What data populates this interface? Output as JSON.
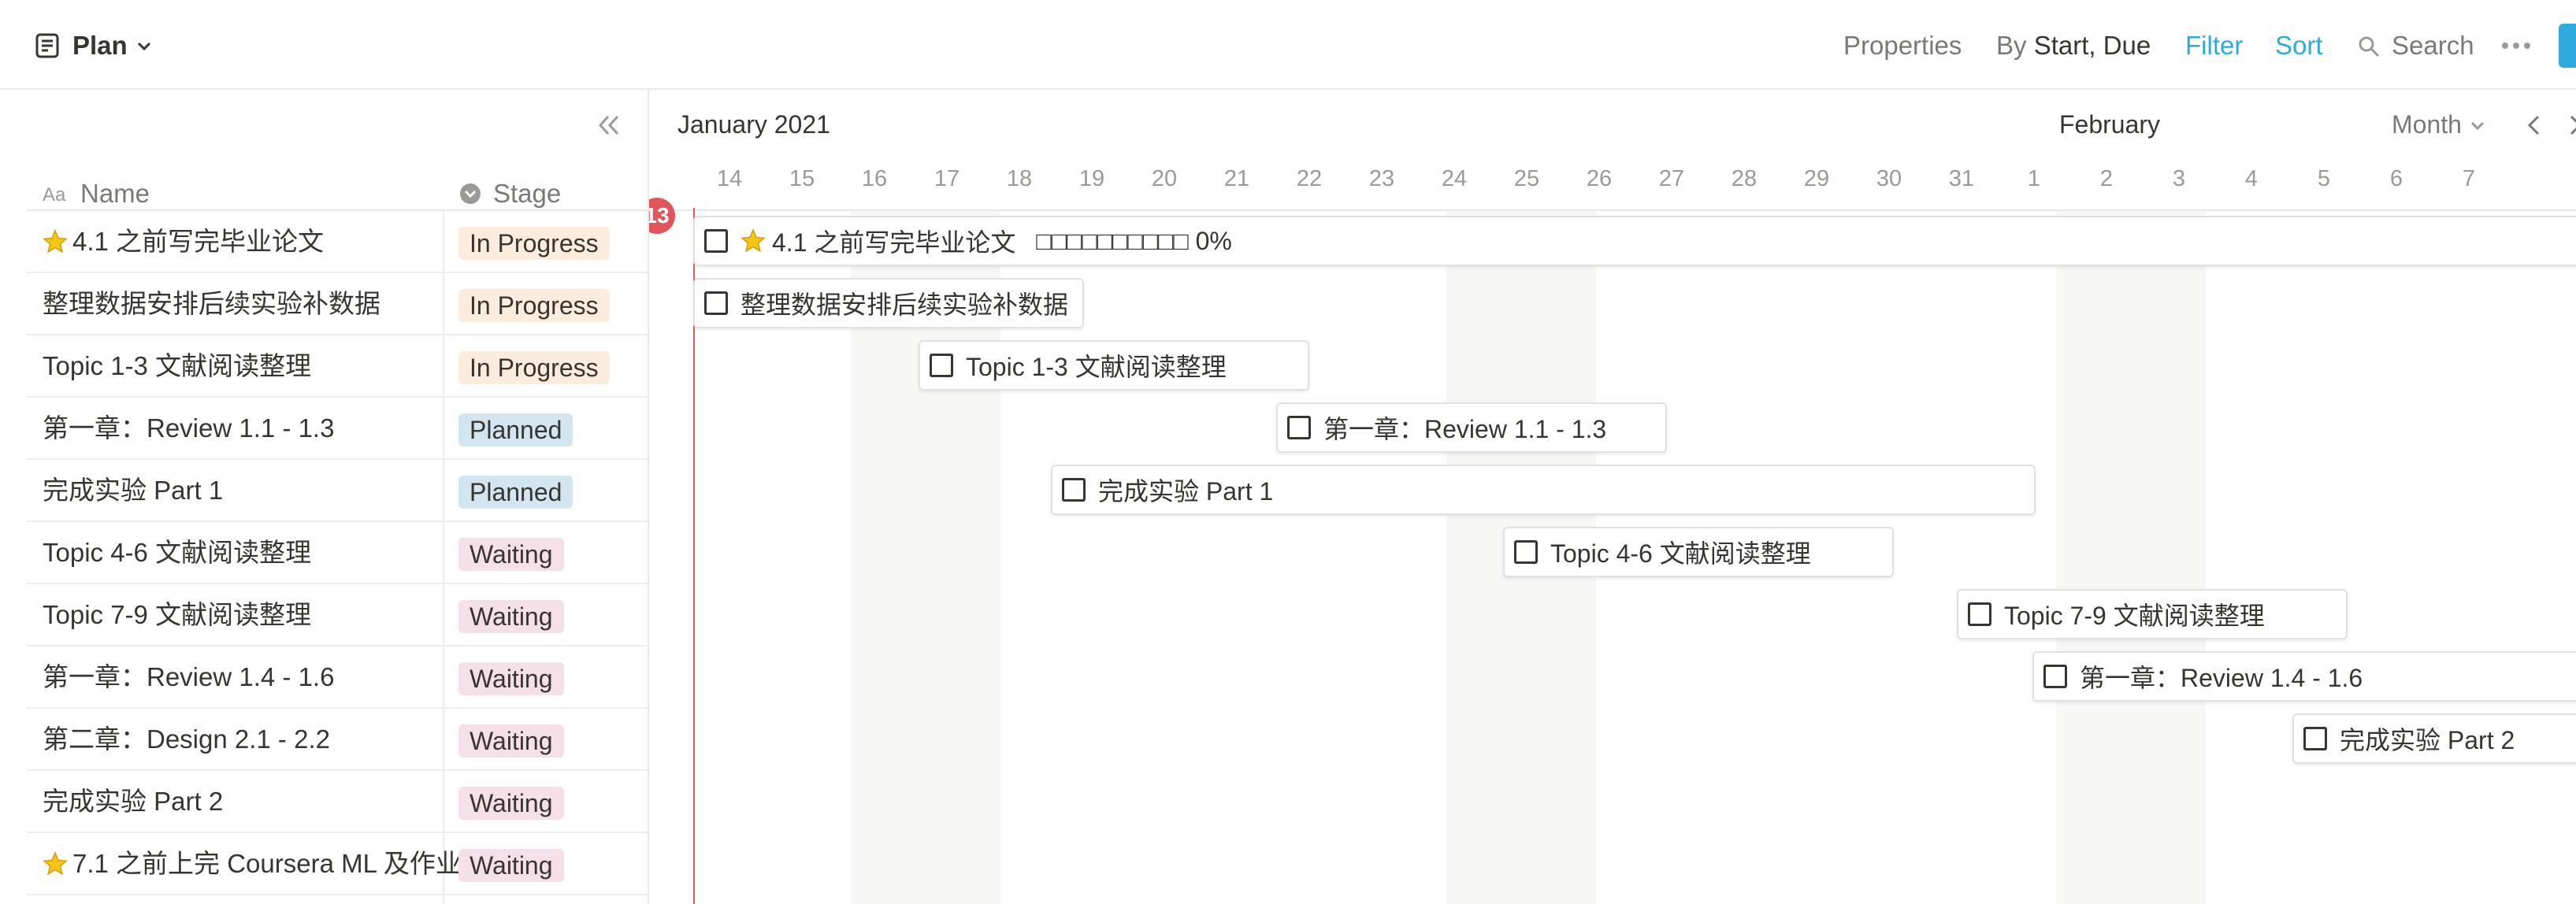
{
  "view": {
    "title": "Plan"
  },
  "toolbar": {
    "properties": "Properties",
    "by_prefix": "By",
    "by_value": "Start, Due",
    "filter": "Filter",
    "sort": "Sort",
    "search": "Search"
  },
  "table": {
    "columns": {
      "name": "Name",
      "stage": "Stage"
    },
    "rows": [
      {
        "name": "4.1 之前写完毕业论文",
        "starred": true,
        "stage": "In Progress"
      },
      {
        "name": "整理数据安排后续实验补数据",
        "starred": false,
        "stage": "In Progress"
      },
      {
        "name": "Topic 1-3 文献阅读整理",
        "starred": false,
        "stage": "In Progress"
      },
      {
        "name": "第一章：Review 1.1 - 1.3",
        "starred": false,
        "stage": "Planned"
      },
      {
        "name": "完成实验 Part 1",
        "starred": false,
        "stage": "Planned"
      },
      {
        "name": "Topic 4-6 文献阅读整理",
        "starred": false,
        "stage": "Waiting"
      },
      {
        "name": "Topic 7-9 文献阅读整理",
        "starred": false,
        "stage": "Waiting"
      },
      {
        "name": "第一章：Review 1.4 - 1.6",
        "starred": false,
        "stage": "Waiting"
      },
      {
        "name": "第二章：Design 2.1 - 2.2",
        "starred": false,
        "stage": "Waiting"
      },
      {
        "name": "完成实验 Part 2",
        "starred": false,
        "stage": "Waiting"
      },
      {
        "name": "7.1 之前上完 Coursera ML 及作业",
        "starred": true,
        "stage": "Waiting"
      }
    ]
  },
  "timeline": {
    "month_jan": "January 2021",
    "month_feb": "February",
    "zoom": "Month",
    "today": "13",
    "days": [
      "14",
      "15",
      "16",
      "17",
      "18",
      "19",
      "20",
      "21",
      "22",
      "23",
      "24",
      "25",
      "26",
      "27",
      "28",
      "29",
      "30",
      "31",
      "1",
      "2",
      "3",
      "4",
      "5",
      "6",
      "7"
    ],
    "bars": [
      {
        "label": "4.1 之前写完毕业论文",
        "starred": true,
        "progress": "□□□□□□□□□□ 0%",
        "start": "Jan 13",
        "end": "after Feb 7"
      },
      {
        "label": "整理数据安排后续实验补数据",
        "starred": false,
        "start": "Jan 13",
        "end": "Jan 17"
      },
      {
        "label": "Topic 1-3 文献阅读整理",
        "starred": false,
        "start": "Jan 16",
        "end": "Jan 20"
      },
      {
        "label": "第一章：Review 1.1 - 1.3",
        "starred": false,
        "start": "Jan 21",
        "end": "Jan 25"
      },
      {
        "label": "完成实验 Part 1",
        "starred": false,
        "start": "Jan 18",
        "end": "Jan 31"
      },
      {
        "label": "Topic 4-6 文献阅读整理",
        "starred": false,
        "start": "Jan 24",
        "end": "Jan 27"
      },
      {
        "label": "Topic 7-9 文献阅读整理",
        "starred": false,
        "start": "Jan 30",
        "end": "Feb 3"
      },
      {
        "label": "第一章：Review 1.4 - 1.6",
        "starred": false,
        "start": "Jan 31",
        "end": "after Feb 7"
      },
      {
        "label": "完成实验 Part 2",
        "starred": false,
        "start": "Feb 4",
        "end": "after Feb 7"
      }
    ]
  },
  "colors": {
    "accent": "#2eaadc",
    "today": "#e0565b",
    "in_progress": "#fbecdd",
    "planned": "#d3e5ef",
    "waiting": "#f5e0e9",
    "star": "#f5c518"
  }
}
